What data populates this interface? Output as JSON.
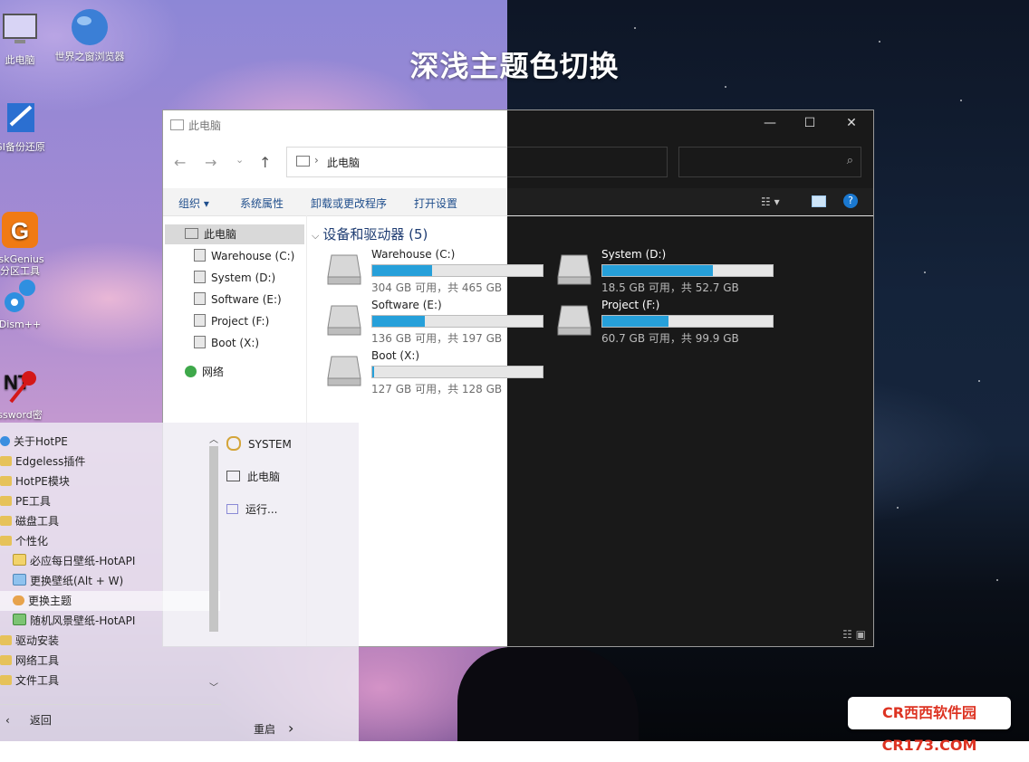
{
  "headline": "深浅主题色切换",
  "desktop_icons": [
    {
      "label": "此电脑",
      "icon": "computer-icon"
    },
    {
      "label": "世界之窗浏览器",
      "icon": "globe-icon"
    },
    {
      "label": "GI备份还原",
      "icon": "backup-icon"
    },
    {
      "label": "iskGenius\n分区工具",
      "icon": "diskgenius-icon"
    },
    {
      "label": "Dism++",
      "icon": "gears-icon"
    },
    {
      "label": "ssword密",
      "icon": "password-key-icon"
    }
  ],
  "explorer": {
    "title": "此电脑",
    "address": "此电脑",
    "window_buttons": {
      "minimize": "—",
      "maximize": "☐",
      "close": "✕"
    },
    "ribbon": [
      "组织 ▾",
      "系统属性",
      "卸载或更改程序",
      "打开设置"
    ],
    "nav": {
      "this_pc": "此电脑",
      "drives": [
        "Warehouse (C:)",
        "System (D:)",
        "Software (E:)",
        "Project (F:)",
        "Boot (X:)"
      ],
      "network": "网络"
    },
    "section_title": "设备和驱动器 (5)",
    "drives": [
      {
        "name": "Warehouse (C:)",
        "capacity": "304 GB 可用，共 465 GB",
        "used_fraction": 0.35
      },
      {
        "name": "System (D:)",
        "capacity": "18.5 GB 可用，共 52.7 GB",
        "used_fraction": 0.65
      },
      {
        "name": "Software (E:)",
        "capacity": "136 GB 可用，共 197 GB",
        "used_fraction": 0.31
      },
      {
        "name": "Project (F:)",
        "capacity": "60.7 GB 可用，共 99.9 GB",
        "used_fraction": 0.39
      },
      {
        "name": "Boot (X:)",
        "capacity": "127 GB 可用，共 128 GB",
        "used_fraction": 0.01
      }
    ],
    "accent_color": "#26a0da"
  },
  "start_menu": {
    "items": [
      {
        "label": "关于HotPE",
        "sub": false
      },
      {
        "label": "Edgeless插件",
        "sub": false
      },
      {
        "label": "HotPE模块",
        "sub": false
      },
      {
        "label": "PE工具",
        "sub": false
      },
      {
        "label": "磁盘工具",
        "sub": false
      },
      {
        "label": "个性化",
        "sub": false
      },
      {
        "label": "必应每日壁纸-HotAPI",
        "sub": true
      },
      {
        "label": "更换壁纸(Alt + W)",
        "sub": true
      },
      {
        "label": "更换主题",
        "sub": true
      },
      {
        "label": "随机风景壁纸-HotAPI",
        "sub": true
      },
      {
        "label": "驱动安装",
        "sub": false
      },
      {
        "label": "网络工具",
        "sub": false
      },
      {
        "label": "文件工具",
        "sub": false
      }
    ],
    "right": {
      "user": "SYSTEM",
      "this_pc": "此电脑",
      "run": "运行..."
    },
    "back": "返回",
    "restart": "重启"
  },
  "watermark": "CR西西软件园 CR173.COM"
}
